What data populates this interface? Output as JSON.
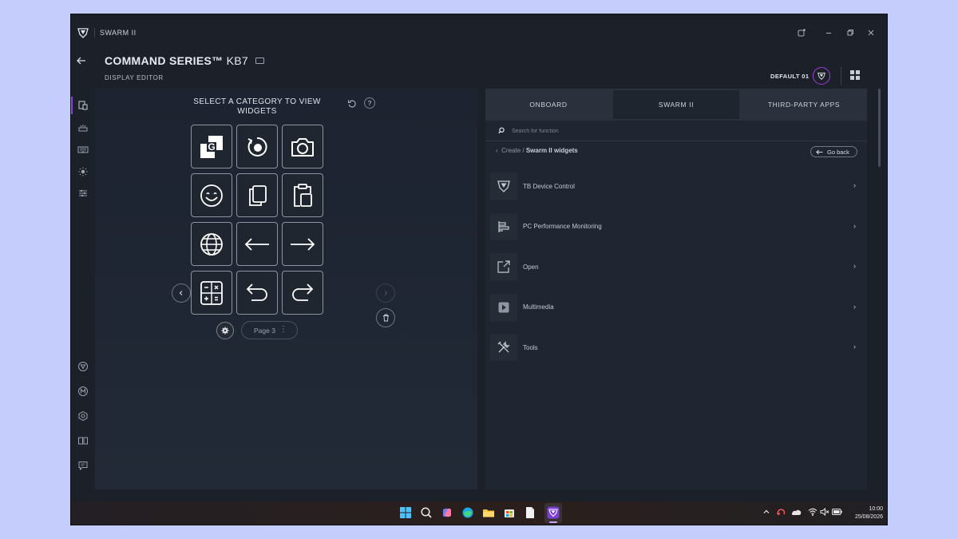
{
  "app": {
    "title": "SWARM II",
    "window_controls": [
      "notification",
      "minimize",
      "restore",
      "close"
    ]
  },
  "header": {
    "device_brand": "COMMAND SERIES™",
    "device_model": "KB7",
    "subtitle": "DISPLAY EDITOR",
    "profile_label": "DEFAULT 01"
  },
  "sidebar": {
    "items": [
      "display-editor-icon",
      "lighting-icon",
      "keyboard-icon",
      "brightness-icon",
      "sliders-icon"
    ],
    "bottom_items": [
      "turtle-beach-icon",
      "macro-icon",
      "settings-hex-icon",
      "devices-icon",
      "feedback-icon"
    ]
  },
  "editor": {
    "heading": "SELECT A CATEGORY TO VIEW WIDGETS",
    "keys": [
      "g-logo-icon",
      "refresh-dot-icon",
      "camera-icon",
      "smiley-icon",
      "copy-icon",
      "paste-icon",
      "globe-icon",
      "arrow-left-icon",
      "arrow-right-icon",
      "calculator-icon",
      "undo-icon",
      "redo-icon"
    ],
    "page_label": "Page 3",
    "page_menu": "⋮"
  },
  "panel": {
    "tabs": [
      {
        "label": "ONBOARD",
        "active": false
      },
      {
        "label": "SWARM II",
        "active": true
      },
      {
        "label": "THIRD-PARTY APPS",
        "active": false
      }
    ],
    "search_placeholder": "Search for function",
    "breadcrumb_root": "Create",
    "breadcrumb_sep": "/",
    "breadcrumb_current": "Swarm II widgets",
    "go_back_label": "Go back",
    "categories": [
      {
        "label": "TB Device Control",
        "icon": "turtle-beach-shield-icon"
      },
      {
        "label": "PC Performance Monitoring",
        "icon": "performance-bars-icon"
      },
      {
        "label": "Open",
        "icon": "open-external-icon"
      },
      {
        "label": "Multimedia",
        "icon": "play-icon"
      },
      {
        "label": "Tools",
        "icon": "tools-icon"
      }
    ]
  },
  "taskbar": {
    "apps": [
      "windows-start-icon",
      "search-icon",
      "copilot-icon",
      "edge-icon",
      "file-explorer-icon",
      "store-icon",
      "notepad-icon",
      "swarm-ii-icon"
    ],
    "time": "10:00",
    "date": "25/08/2026"
  },
  "colors": {
    "accent": "#8a46e0",
    "background": "#1b2029",
    "desktop": "#c4cdfb"
  }
}
